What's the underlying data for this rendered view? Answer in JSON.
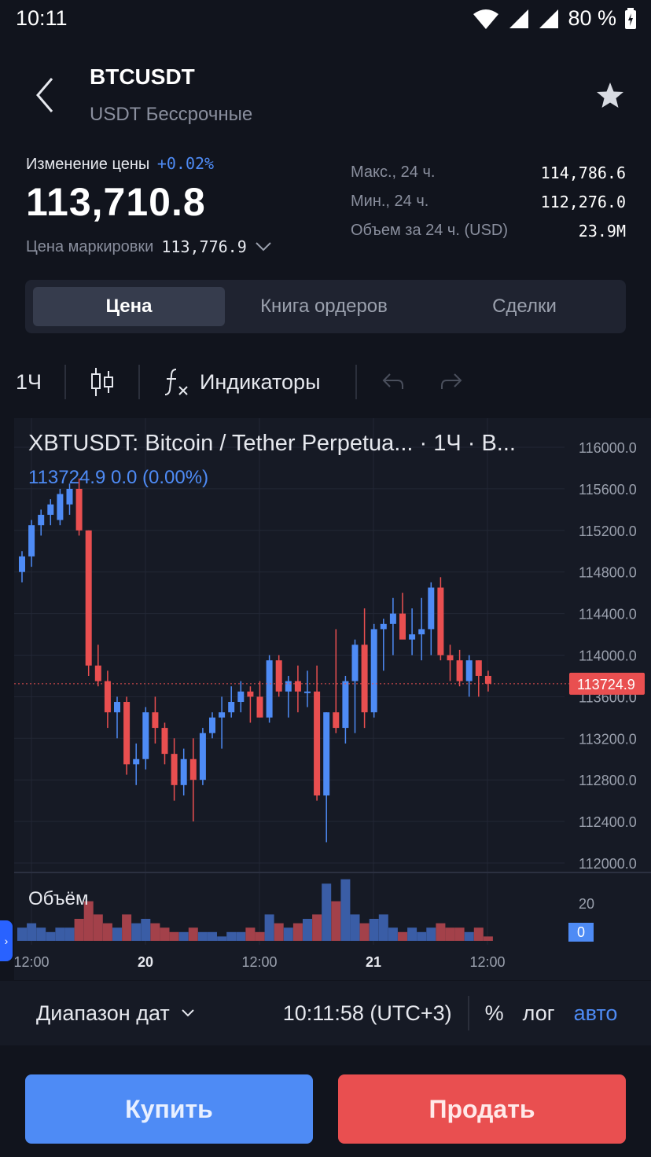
{
  "status_bar": {
    "time": "10:11",
    "battery": "80 %"
  },
  "header": {
    "symbol": "BTCUSDT",
    "subtitle": "USDT Бессрочные"
  },
  "price_block": {
    "change_label": "Изменение цены",
    "change_value": "+0.02%",
    "last_price": "113,710.8",
    "mark_label": "Цена маркировки",
    "mark_value": "113,776.9"
  },
  "stats": [
    {
      "label": "Макс., 24 ч.",
      "value": "114,786.6"
    },
    {
      "label": "Мин., 24 ч.",
      "value": "112,276.0"
    },
    {
      "label": "Объем за 24 ч. (USD)",
      "value": "23.9M"
    }
  ],
  "tabs": [
    "Цена",
    "Книга ордеров",
    "Сделки"
  ],
  "toolbar": {
    "interval": "1Ч",
    "indicators": "Индикаторы"
  },
  "chart": {
    "title": "XBTUSDT: Bitcoin / Tether Perpetua... · 1Ч · B...",
    "ohlc_line": "113724.9  0.0 (0.00%)",
    "volume_label": "Объём",
    "price_ticks": [
      "116000.0",
      "115600.0",
      "115200.0",
      "114800.0",
      "114400.0",
      "114000.0",
      "113600.0",
      "113200.0",
      "112800.0",
      "112400.0",
      "112000.0"
    ],
    "current_price_tag": "113724.9",
    "volume_ticks": [
      "20",
      "0"
    ],
    "time_labels": [
      "12:00",
      "20",
      "12:00",
      "21",
      "12:00"
    ],
    "colors": {
      "up": "#4e8bf5",
      "down": "#e94f50",
      "bg": "#161a25"
    }
  },
  "chart_data": {
    "type": "candlestick",
    "ylim": [
      112000,
      116000
    ],
    "current_price": 113724.9,
    "candles": [
      {
        "o": 114800,
        "h": 115000,
        "l": 114700,
        "c": 114950
      },
      {
        "o": 114950,
        "h": 115300,
        "l": 114850,
        "c": 115250
      },
      {
        "o": 115250,
        "h": 115400,
        "l": 115150,
        "c": 115350
      },
      {
        "o": 115350,
        "h": 115500,
        "l": 115250,
        "c": 115450
      },
      {
        "o": 115300,
        "h": 115600,
        "l": 115250,
        "c": 115550
      },
      {
        "o": 115450,
        "h": 115650,
        "l": 115350,
        "c": 115600
      },
      {
        "o": 115600,
        "h": 115700,
        "l": 115150,
        "c": 115200
      },
      {
        "o": 115200,
        "h": 115200,
        "l": 113800,
        "c": 113900
      },
      {
        "o": 113900,
        "h": 114100,
        "l": 113700,
        "c": 113750
      },
      {
        "o": 113750,
        "h": 113850,
        "l": 113300,
        "c": 113450
      },
      {
        "o": 113450,
        "h": 113600,
        "l": 113200,
        "c": 113550
      },
      {
        "o": 113550,
        "h": 113600,
        "l": 112850,
        "c": 112950
      },
      {
        "o": 112950,
        "h": 113150,
        "l": 112750,
        "c": 113000
      },
      {
        "o": 113000,
        "h": 113500,
        "l": 112900,
        "c": 113450
      },
      {
        "o": 113450,
        "h": 113600,
        "l": 113150,
        "c": 113300
      },
      {
        "o": 113300,
        "h": 113350,
        "l": 112950,
        "c": 113050
      },
      {
        "o": 113050,
        "h": 113200,
        "l": 112600,
        "c": 112750
      },
      {
        "o": 112750,
        "h": 113100,
        "l": 112650,
        "c": 113000
      },
      {
        "o": 113000,
        "h": 113200,
        "l": 112400,
        "c": 112800
      },
      {
        "o": 112800,
        "h": 113300,
        "l": 112750,
        "c": 113250
      },
      {
        "o": 113250,
        "h": 113450,
        "l": 113200,
        "c": 113400
      },
      {
        "o": 113400,
        "h": 113600,
        "l": 113100,
        "c": 113450
      },
      {
        "o": 113450,
        "h": 113700,
        "l": 113400,
        "c": 113550
      },
      {
        "o": 113550,
        "h": 113750,
        "l": 113450,
        "c": 113650
      },
      {
        "o": 113650,
        "h": 113700,
        "l": 113350,
        "c": 113600
      },
      {
        "o": 113600,
        "h": 113750,
        "l": 113400,
        "c": 113400
      },
      {
        "o": 113400,
        "h": 114000,
        "l": 113350,
        "c": 113950
      },
      {
        "o": 113950,
        "h": 114000,
        "l": 113600,
        "c": 113650
      },
      {
        "o": 113650,
        "h": 113800,
        "l": 113400,
        "c": 113750
      },
      {
        "o": 113750,
        "h": 113900,
        "l": 113450,
        "c": 113650
      },
      {
        "o": 113650,
        "h": 113850,
        "l": 113500,
        "c": 113650
      },
      {
        "o": 113650,
        "h": 113900,
        "l": 112600,
        "c": 112650
      },
      {
        "o": 112650,
        "h": 113450,
        "l": 112200,
        "c": 113450
      },
      {
        "o": 113450,
        "h": 114250,
        "l": 113250,
        "c": 113300
      },
      {
        "o": 113300,
        "h": 113800,
        "l": 113150,
        "c": 113750
      },
      {
        "o": 113750,
        "h": 114150,
        "l": 113250,
        "c": 114100
      },
      {
        "o": 114100,
        "h": 114450,
        "l": 113300,
        "c": 113450
      },
      {
        "o": 113450,
        "h": 114300,
        "l": 113400,
        "c": 114250
      },
      {
        "o": 114250,
        "h": 114350,
        "l": 113850,
        "c": 114300
      },
      {
        "o": 114300,
        "h": 114550,
        "l": 114000,
        "c": 114400
      },
      {
        "o": 114400,
        "h": 114600,
        "l": 114200,
        "c": 114150
      },
      {
        "o": 114150,
        "h": 114450,
        "l": 114000,
        "c": 114200
      },
      {
        "o": 114200,
        "h": 114550,
        "l": 113950,
        "c": 114250
      },
      {
        "o": 114250,
        "h": 114700,
        "l": 114000,
        "c": 114650
      },
      {
        "o": 114650,
        "h": 114750,
        "l": 113950,
        "c": 114000
      },
      {
        "o": 114000,
        "h": 114100,
        "l": 113750,
        "c": 113950
      },
      {
        "o": 113950,
        "h": 114050,
        "l": 113700,
        "c": 113750
      },
      {
        "o": 113750,
        "h": 114000,
        "l": 113600,
        "c": 113950
      },
      {
        "o": 113950,
        "h": 113950,
        "l": 113600,
        "c": 113800
      },
      {
        "o": 113800,
        "h": 113850,
        "l": 113650,
        "c": 113724.9
      }
    ],
    "volume": [
      3,
      4,
      3,
      2,
      3,
      3,
      5,
      9,
      6,
      4,
      3,
      6,
      4,
      5,
      4,
      3,
      2,
      2,
      3,
      2,
      2,
      1,
      2,
      2,
      3,
      2,
      6,
      4,
      3,
      4,
      5,
      6,
      13,
      9,
      14,
      6,
      4,
      5,
      6,
      3,
      2,
      3,
      2,
      3,
      4,
      3,
      3,
      2,
      3,
      1
    ]
  },
  "footer": {
    "date_range": "Диапазон дат",
    "clock": "10:11:58 (UTC+3)",
    "percent": "%",
    "log": "лог",
    "auto": "авто"
  },
  "actions": {
    "buy": "Купить",
    "sell": "Продать"
  }
}
